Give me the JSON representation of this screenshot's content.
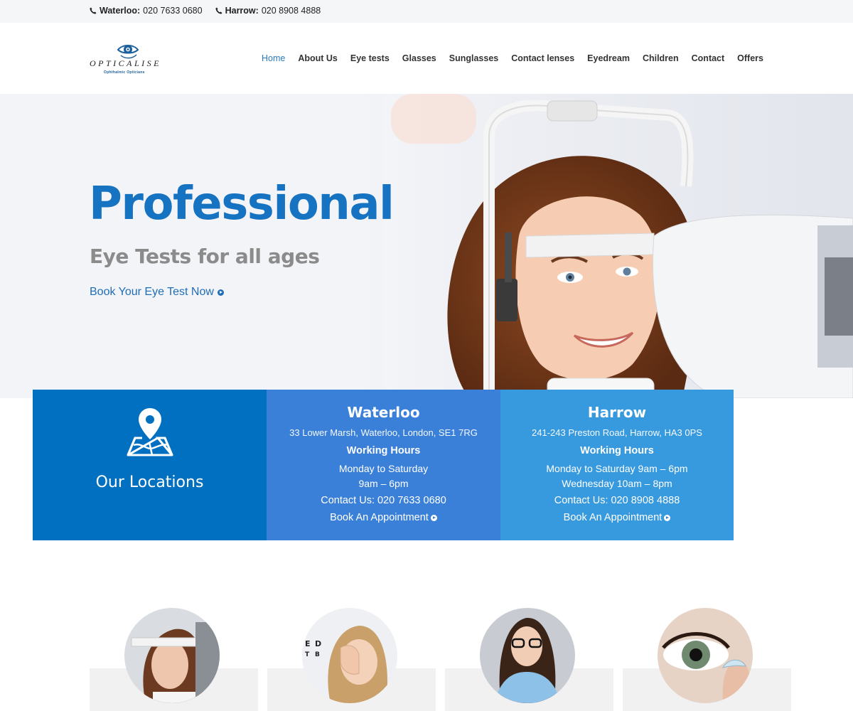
{
  "topbar": {
    "phones": [
      {
        "label": "Waterloo:",
        "number": "020 7633 0680",
        "icon": "phone-icon"
      },
      {
        "label": "Harrow:",
        "number": "020 8908 4888",
        "icon": "phone-icon"
      }
    ]
  },
  "header": {
    "logo_text": "OPTICALISE",
    "logo_subtext": "Ophthalmic Opticians",
    "nav": [
      {
        "label": "Home",
        "active": true
      },
      {
        "label": "About Us"
      },
      {
        "label": "Eye tests"
      },
      {
        "label": "Glasses"
      },
      {
        "label": "Sunglasses"
      },
      {
        "label": "Contact lenses"
      },
      {
        "label": "Eyedream"
      },
      {
        "label": "Children"
      },
      {
        "label": "Contact"
      },
      {
        "label": "Offers"
      }
    ]
  },
  "hero": {
    "title": "Professional",
    "subtitle": "Eye Tests for all ages",
    "cta": "Book Your Eye Test Now"
  },
  "locations": {
    "title": "Our Locations",
    "icon": "map-pin-icon",
    "waterloo": {
      "name": "Waterloo",
      "address": "33 Lower Marsh, Waterloo, London, SE1 7RG",
      "hours_title": "Working Hours",
      "hours": [
        "Monday to Saturday",
        "9am – 6pm"
      ],
      "contact": "Contact Us: 020 7633 0680",
      "book": "Book An Appointment"
    },
    "harrow": {
      "name": "Harrow",
      "address": "241-243 Preston Road, Harrow, HA3 0PS",
      "hours_title": "Working Hours",
      "hours": [
        "Monday to Saturday 9am – 6pm",
        "Wednesday 10am – 8pm"
      ],
      "contact": "Contact Us: 020 8908 4888",
      "book": "Book An Appointment"
    }
  },
  "colors": {
    "brand_blue": "#1673c2",
    "panel_main": "#0270c0",
    "panel_waterloo": "#3a80d9",
    "panel_harrow": "#3799de",
    "link_blue": "#2b7bbf"
  }
}
